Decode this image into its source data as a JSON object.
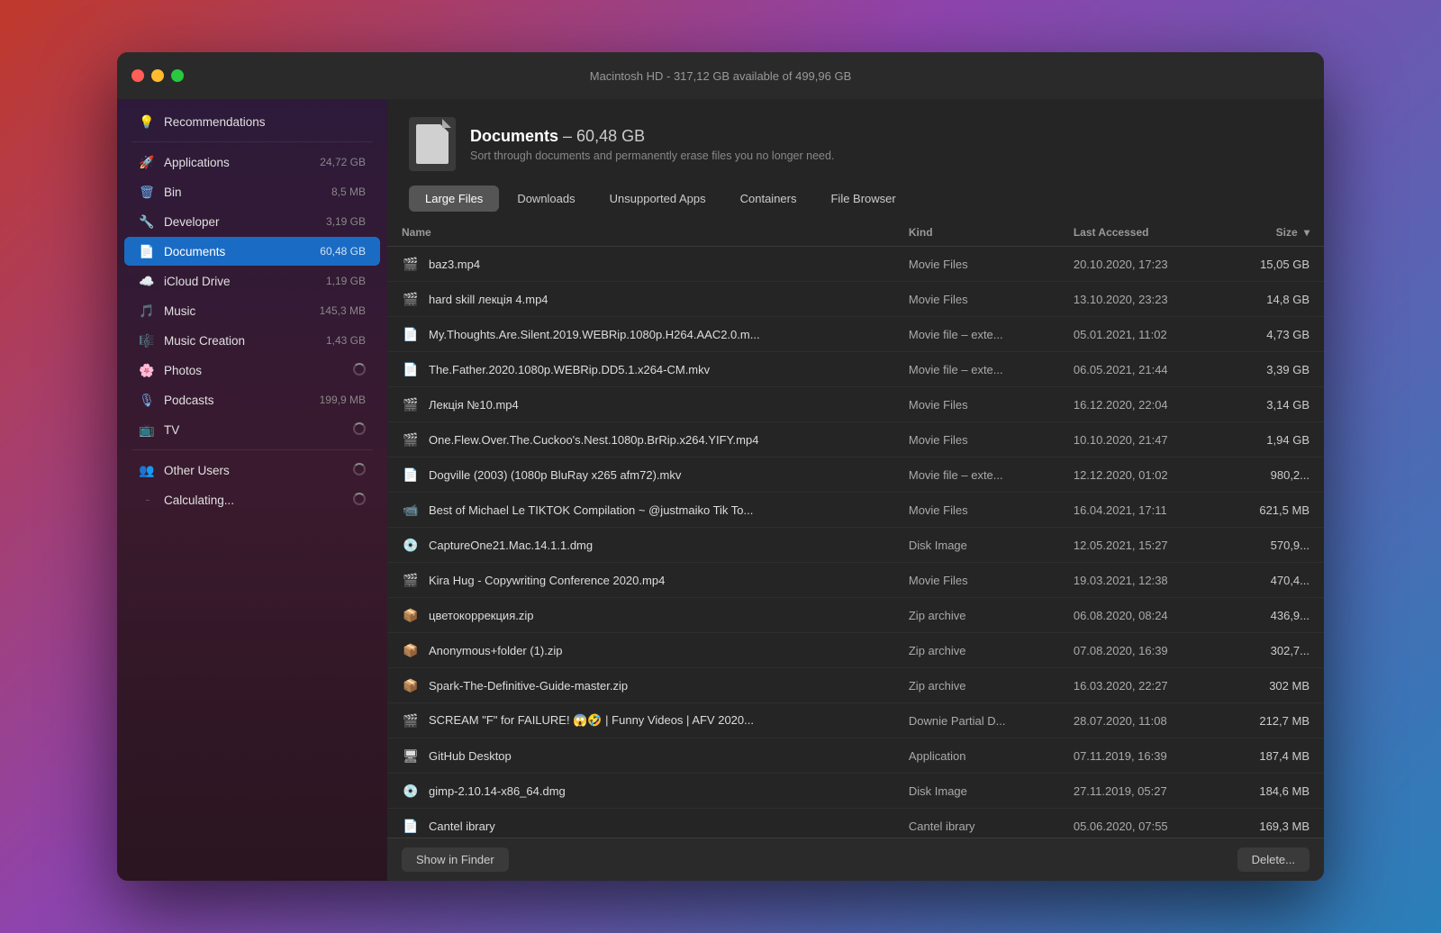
{
  "window": {
    "title": "Macintosh HD - 317,12 GB available of 499,96 GB"
  },
  "sidebar": {
    "items": [
      {
        "id": "recommendations",
        "label": "Recommendations",
        "icon": "💡",
        "size": ""
      },
      {
        "id": "applications",
        "label": "Applications",
        "icon": "🚀",
        "size": "24,72 GB"
      },
      {
        "id": "bin",
        "label": "Bin",
        "icon": "🗑",
        "size": "8,5 MB"
      },
      {
        "id": "developer",
        "label": "Developer",
        "icon": "🔧",
        "size": "3,19 GB"
      },
      {
        "id": "documents",
        "label": "Documents",
        "icon": "📄",
        "size": "60,48 GB",
        "active": true
      },
      {
        "id": "icloud",
        "label": "iCloud Drive",
        "icon": "☁️",
        "size": "1,19 GB"
      },
      {
        "id": "music",
        "label": "Music",
        "icon": "🎵",
        "size": "145,3 MB"
      },
      {
        "id": "music-creation",
        "label": "Music Creation",
        "icon": "🎼",
        "size": "1,43 GB"
      },
      {
        "id": "photos",
        "label": "Photos",
        "icon": "🌸",
        "size": "",
        "loading": true
      },
      {
        "id": "podcasts",
        "label": "Podcasts",
        "icon": "🎙",
        "size": "199,9 MB"
      },
      {
        "id": "tv",
        "label": "TV",
        "icon": "📺",
        "size": "",
        "loading": true
      }
    ],
    "divider_after": [
      "tv"
    ],
    "bottom_items": [
      {
        "id": "other-users",
        "label": "Other Users",
        "icon": "👥",
        "size": "",
        "loading": true
      },
      {
        "id": "calculating",
        "label": "Calculating...",
        "icon": "···",
        "size": "",
        "loading": true
      }
    ]
  },
  "panel": {
    "doc_name": "Documents",
    "doc_size": "60,48 GB",
    "doc_subtitle": "Sort through documents and permanently erase files you no longer need.",
    "tabs": [
      {
        "id": "large-files",
        "label": "Large Files",
        "active": true
      },
      {
        "id": "downloads",
        "label": "Downloads",
        "active": false
      },
      {
        "id": "unsupported-apps",
        "label": "Unsupported Apps",
        "active": false
      },
      {
        "id": "containers",
        "label": "Containers",
        "active": false
      },
      {
        "id": "file-browser",
        "label": "File Browser",
        "active": false
      }
    ],
    "table": {
      "columns": [
        "Name",
        "Kind",
        "Last Accessed",
        "Size"
      ],
      "rows": [
        {
          "name": "baz3.mp4",
          "kind": "Movie Files",
          "accessed": "20.10.2020, 17:23",
          "size": "15,05 GB",
          "icon": "🎬"
        },
        {
          "name": "hard skill лекція 4.mp4",
          "kind": "Movie Files",
          "accessed": "13.10.2020, 23:23",
          "size": "14,8 GB",
          "icon": "🎬"
        },
        {
          "name": "My.Thoughts.Are.Silent.2019.WEBRip.1080p.H264.AAC2.0.m...",
          "kind": "Movie file – exte...",
          "accessed": "05.01.2021, 11:02",
          "size": "4,73 GB",
          "icon": "📄"
        },
        {
          "name": "The.Father.2020.1080p.WEBRip.DD5.1.x264-CM.mkv",
          "kind": "Movie file – exte...",
          "accessed": "06.05.2021, 21:44",
          "size": "3,39 GB",
          "icon": "📄"
        },
        {
          "name": "Лекція №10.mp4",
          "kind": "Movie Files",
          "accessed": "16.12.2020, 22:04",
          "size": "3,14 GB",
          "icon": "🎬"
        },
        {
          "name": "One.Flew.Over.The.Cuckoo's.Nest.1080p.BrRip.x264.YIFY.mp4",
          "kind": "Movie Files",
          "accessed": "10.10.2020, 21:47",
          "size": "1,94 GB",
          "icon": "🎬"
        },
        {
          "name": "Dogville (2003) (1080p BluRay x265 afm72).mkv",
          "kind": "Movie file – exte...",
          "accessed": "12.12.2020, 01:02",
          "size": "980,2...",
          "icon": "📄"
        },
        {
          "name": "Best of Michael Le TIKTOK Compilation ~ @justmaiko Tik To...",
          "kind": "Movie Files",
          "accessed": "16.04.2021, 17:11",
          "size": "621,5 MB",
          "icon": "📹"
        },
        {
          "name": "CaptureOne21.Mac.14.1.1.dmg",
          "kind": "Disk Image",
          "accessed": "12.05.2021, 15:27",
          "size": "570,9...",
          "icon": "💿"
        },
        {
          "name": "Kira Hug - Copywriting Conference 2020.mp4",
          "kind": "Movie Files",
          "accessed": "19.03.2021, 12:38",
          "size": "470,4...",
          "icon": "🎬"
        },
        {
          "name": "цветокоррекция.zip",
          "kind": "Zip archive",
          "accessed": "06.08.2020, 08:24",
          "size": "436,9...",
          "icon": "📦"
        },
        {
          "name": "Anonymous+folder (1).zip",
          "kind": "Zip archive",
          "accessed": "07.08.2020, 16:39",
          "size": "302,7...",
          "icon": "📦"
        },
        {
          "name": "Spark-The-Definitive-Guide-master.zip",
          "kind": "Zip archive",
          "accessed": "16.03.2020, 22:27",
          "size": "302 MB",
          "icon": "📦"
        },
        {
          "name": "SCREAM \"F\" for FAILURE! 😱🤣 | Funny Videos | AFV 2020...",
          "kind": "Downie Partial D...",
          "accessed": "28.07.2020, 11:08",
          "size": "212,7 MB",
          "icon": "🎬"
        },
        {
          "name": "GitHub Desktop",
          "kind": "Application",
          "accessed": "07.11.2019, 16:39",
          "size": "187,4 MB",
          "icon": "🖥"
        },
        {
          "name": "gimp-2.10.14-x86_64.dmg",
          "kind": "Disk Image",
          "accessed": "27.11.2019, 05:27",
          "size": "184,6 MB",
          "icon": "💿"
        },
        {
          "name": "Cantel ibrary",
          "kind": "Cantel ibrary",
          "accessed": "05.06.2020, 07:55",
          "size": "169,3 MB",
          "icon": "📄"
        }
      ]
    },
    "bottom": {
      "show_finder": "Show in Finder",
      "delete": "Delete..."
    }
  }
}
